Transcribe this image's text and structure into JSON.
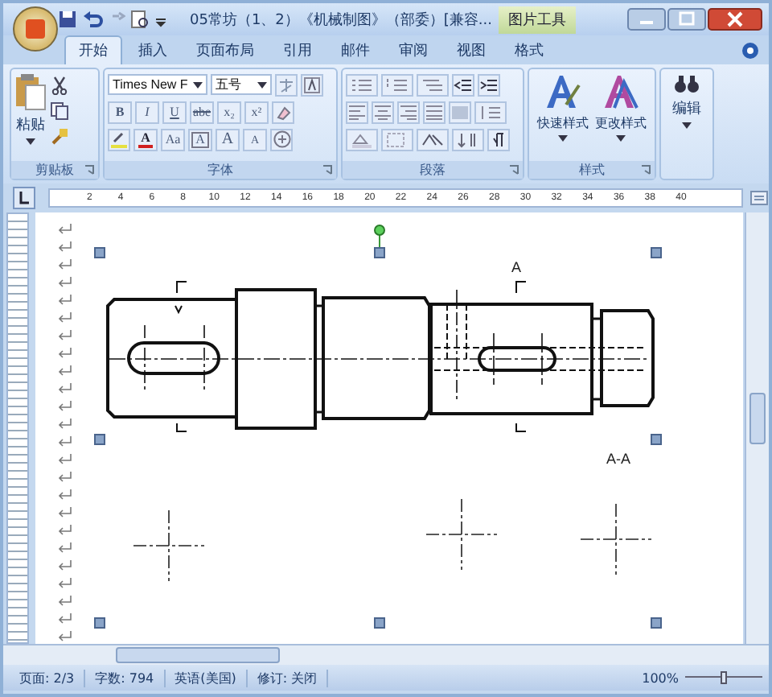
{
  "title_bar": {
    "title": "05常坊（1、2）《机械制图》（部委）[兼容...",
    "context_tab": "图片工具"
  },
  "tabs": [
    {
      "label": "开始",
      "selected": true
    },
    {
      "label": "插入",
      "selected": false
    },
    {
      "label": "页面布局",
      "selected": false
    },
    {
      "label": "引用",
      "selected": false
    },
    {
      "label": "邮件",
      "selected": false
    },
    {
      "label": "审阅",
      "selected": false
    },
    {
      "label": "视图",
      "selected": false
    },
    {
      "label": "格式",
      "selected": false
    }
  ],
  "ribbon": {
    "clipboard": {
      "label": "剪贴板",
      "paste": "粘贴"
    },
    "font": {
      "label": "字体",
      "name": "Times New F",
      "size": "五号",
      "format_buttons": [
        "B",
        "I",
        "U",
        "abe",
        "x₂",
        "x²"
      ],
      "effect_buttons": [
        {
          "kind": "color",
          "label": "A"
        },
        {
          "kind": "text",
          "label": "Aa"
        },
        {
          "kind": "boxed",
          "label": "A"
        },
        {
          "kind": "grow",
          "label": "A"
        },
        {
          "kind": "shrink",
          "label": "A"
        }
      ]
    },
    "paragraph": {
      "label": "段落"
    },
    "styles": {
      "label": "样式",
      "buttons": [
        "快速样式",
        "更改样式"
      ]
    },
    "editing": {
      "label": "编辑"
    }
  },
  "ruler": {
    "ticks": [
      "2",
      "4",
      "6",
      "8",
      "10",
      "12",
      "14",
      "16",
      "18",
      "20",
      "22",
      "24",
      "26",
      "28",
      "30",
      "32",
      "34",
      "36",
      "38",
      "40"
    ]
  },
  "drawing": {
    "labels": [
      {
        "kind": "section",
        "text": "A"
      },
      {
        "kind": "view",
        "text": "A-A"
      }
    ]
  },
  "status_bar": {
    "items": [
      "页面: 2/3",
      "字数: 794",
      "英语(美国)",
      "修订: 关闭"
    ],
    "zoom": "100%",
    "zoom_slider": {
      "level": 0.5
    }
  }
}
